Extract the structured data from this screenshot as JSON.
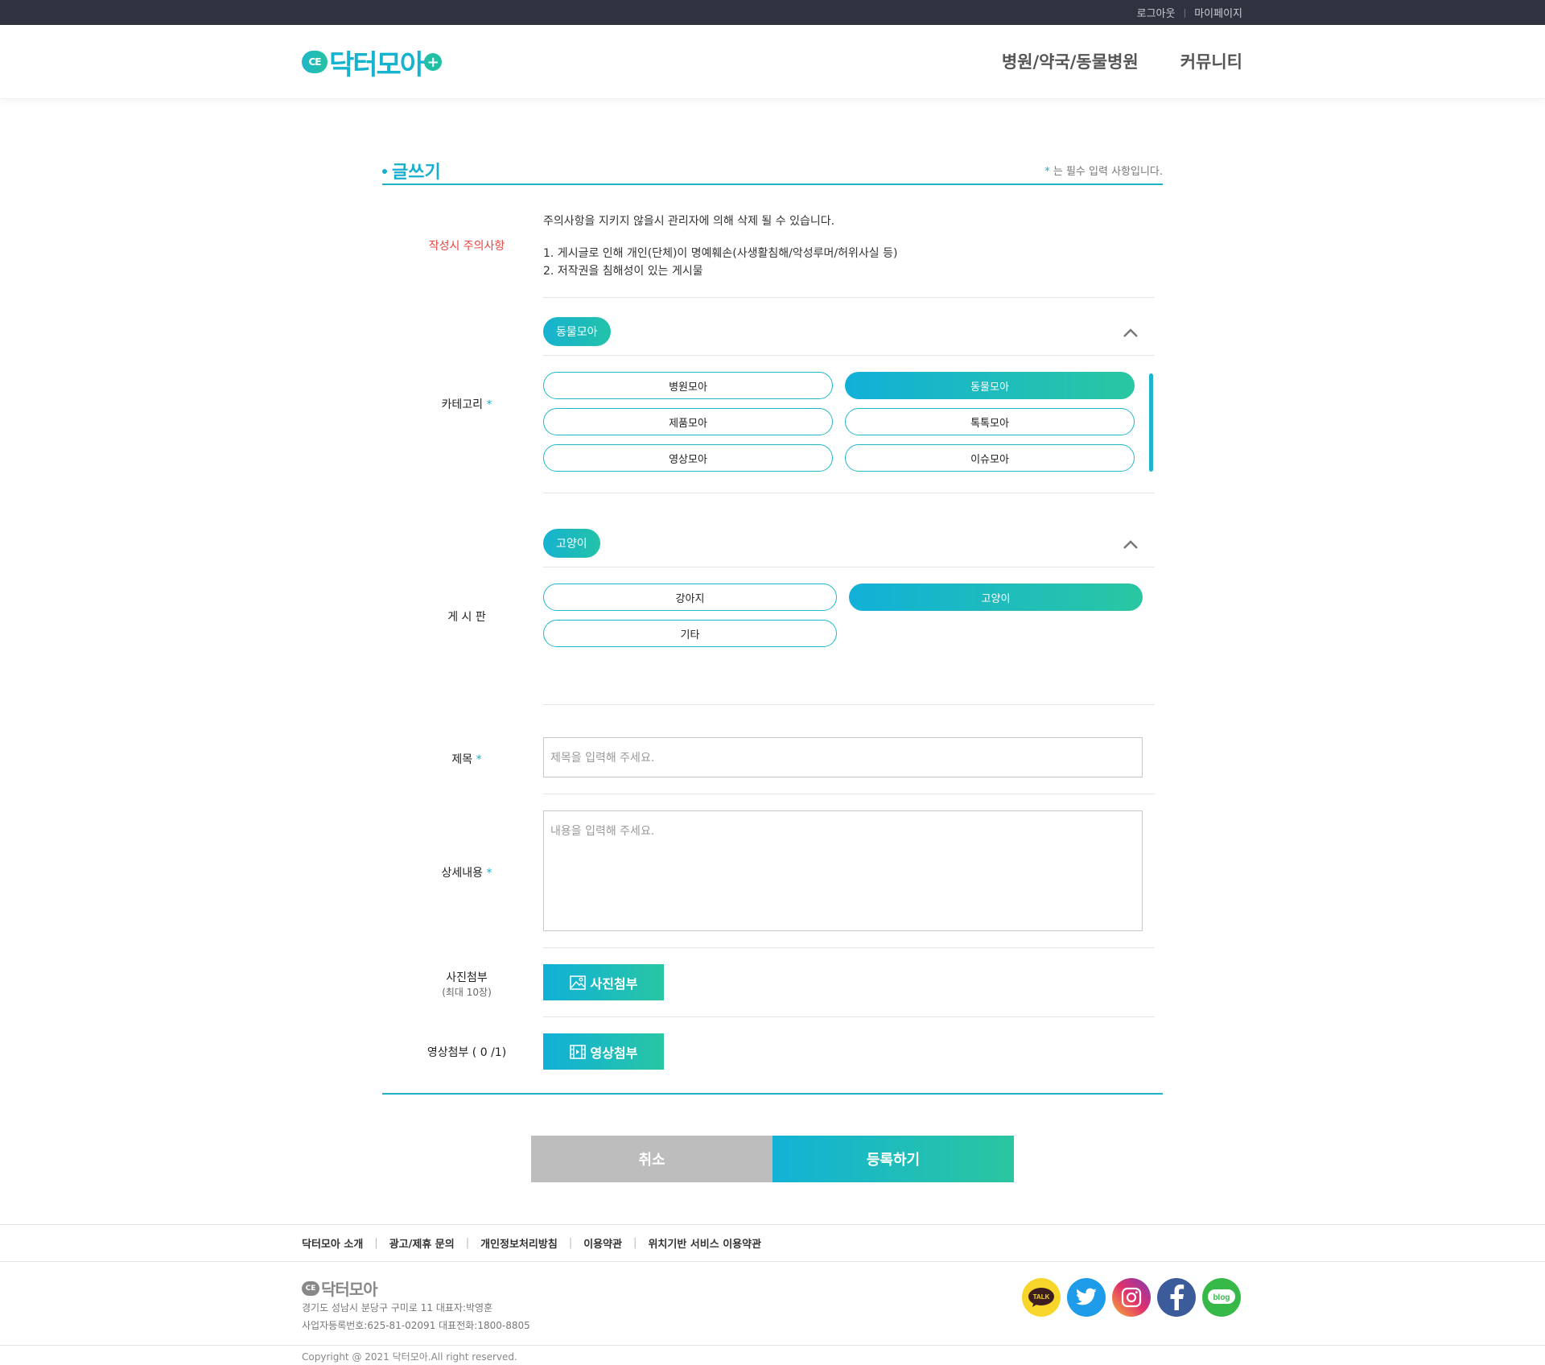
{
  "topbar": {
    "logout": "로그아웃",
    "mypage": "마이페이지",
    "separator": "|"
  },
  "header": {
    "logo_badge": "CE",
    "logo_text": "닥터모아",
    "logo_plus": "+",
    "nav": [
      "병원/약국/동물병원",
      "커뮤니티"
    ]
  },
  "page": {
    "title": "글쓰기",
    "required_star": "*",
    "required_note": " 는 필수 입력 사항입니다."
  },
  "notice": {
    "label": "작성시 주의사항",
    "line1": "주의사항을 지키지 않을시 관리자에 의해 삭제 될 수 있습니다.",
    "line2": "1. 게시글로 인해 개인(단체)이 명예훼손(사생활침해/악성루머/허위사실 등)",
    "line3": "2. 저작권을 침해성이 있는 게시물"
  },
  "category": {
    "label": "카테고리",
    "star": "*",
    "selected": "동물모아",
    "options": [
      "병원모아",
      "동물모아",
      "제품모아",
      "톡톡모아",
      "영상모아",
      "이슈모아"
    ],
    "active_index": 1
  },
  "board": {
    "label": "게 시 판",
    "selected": "고양이",
    "options": [
      "강아지",
      "고양이",
      "기타"
    ],
    "active_index": 1
  },
  "subject": {
    "label": "제목",
    "star": "*",
    "placeholder": "제목을 입력해 주세요."
  },
  "content": {
    "label": "상세내용",
    "star": "*",
    "placeholder": "내용을 입력해 주세요."
  },
  "photo": {
    "label": "사진첨부",
    "sub": "(최대 10장)",
    "button": "사진첨부"
  },
  "video": {
    "label": "영상첨부 ( 0 /1)",
    "button": "영상첨부"
  },
  "actions": {
    "cancel": "취소",
    "submit": "등록하기"
  },
  "footer": {
    "links": [
      "닥터모아 소개",
      "광고/제휴 문의",
      "개인정보처리방침",
      "이용약관",
      "위치기반 서비스 이용약관"
    ],
    "logo_badge": "CE",
    "logo_text": "닥터모아",
    "address": "경기도 성남시 분당구 구미로 11 대표자:박영훈",
    "business": "사업자등록번호:625-81-02091 대표전화:1800-8805",
    "copyright": "Copyright @ 2021 닥터모아.All right reserved.",
    "social": [
      {
        "icon": "kakaotalk-icon",
        "text": "TALK",
        "color": "#f7d52a"
      },
      {
        "icon": "twitter-icon",
        "text": "",
        "color": "#1e9be9"
      },
      {
        "icon": "instagram-icon",
        "text": "",
        "color": "#c1368f"
      },
      {
        "icon": "facebook-icon",
        "text": "",
        "color": "#3b5b9a"
      },
      {
        "icon": "blog-icon",
        "text": "blog",
        "color": "#37b94a"
      }
    ]
  }
}
